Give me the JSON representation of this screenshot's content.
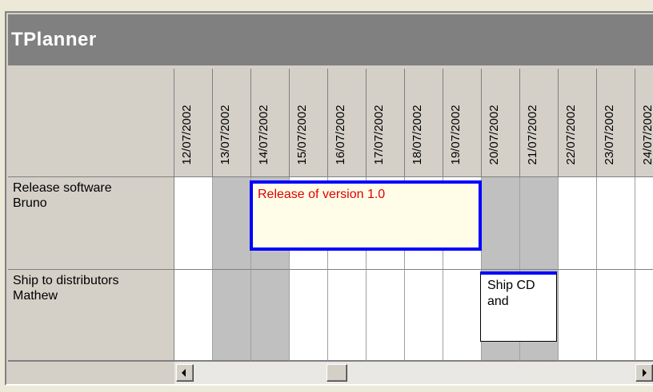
{
  "planner": {
    "title": "TPlanner",
    "dates": [
      "12/07/2002",
      "13/07/2002",
      "14/07/2002",
      "15/07/2002",
      "16/07/2002",
      "17/07/2002",
      "18/07/2002",
      "19/07/2002",
      "20/07/2002",
      "21/07/2002",
      "22/07/2002",
      "23/07/2002",
      "24/07/2002"
    ],
    "weekend_days": [
      "13/07/2002",
      "14/07/2002",
      "20/07/2002",
      "21/07/2002"
    ],
    "rows": [
      {
        "line1": "Release software",
        "line2": "Bruno"
      },
      {
        "line1": "Ship to distributors",
        "line2": "Mathew"
      }
    ],
    "tasks": [
      {
        "text": "Release of version 1.0",
        "start": "14/07/2002",
        "end": "19/07/2002",
        "row": 0,
        "color": "#e00000",
        "border": "#0000ff",
        "fill": "#fffde8"
      },
      {
        "line1": "Ship CD",
        "line2": "and",
        "start": "20/07/2002",
        "end": "21/07/2002",
        "row": 1,
        "color": "#000000",
        "border": "#0000ff",
        "fill": "#ffffff"
      }
    ]
  },
  "scrollbar": {
    "left_icon": "arrow-left-icon",
    "right_icon": "arrow-right-icon"
  },
  "colors": {
    "caption_bg": "#808080",
    "weekend_shade": "#c0c0c0",
    "task_border": "#0000ff"
  }
}
